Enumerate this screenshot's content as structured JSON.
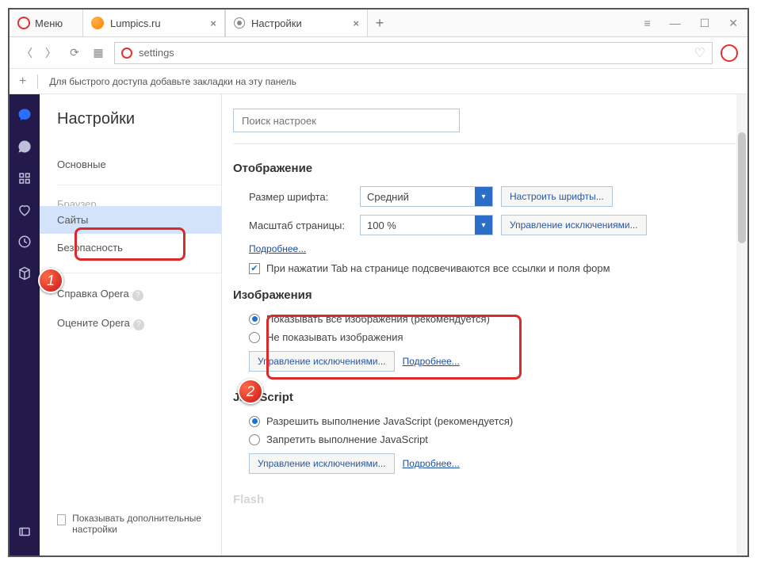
{
  "menu": "Меню",
  "tabs": [
    "Lumpics.ru",
    "Настройки"
  ],
  "url": "settings",
  "bookmarkbar_hint": "Для быстрого доступа добавьте закладки на эту панель",
  "nav_title": "Настройки",
  "nav": {
    "basic": "Основные",
    "browser": "Браузер",
    "sites": "Сайты",
    "security": "Безопасность",
    "help": "Справка Opera",
    "rate": "Оцените Opera"
  },
  "show_advanced": "Показывать дополнительные настройки",
  "search_placeholder": "Поиск настроек",
  "display": {
    "title": "Отображение",
    "font_size_label": "Размер шрифта:",
    "font_size_value": "Средний",
    "font_btn": "Настроить шрифты...",
    "zoom_label": "Масштаб страницы:",
    "zoom_value": "100 %",
    "zoom_btn": "Управление исключениями...",
    "more": "Подробнее...",
    "tab_highlight": "При нажатии Tab на странице подсвечиваются все ссылки и поля форм"
  },
  "images": {
    "title": "Изображения",
    "show_all": "Показывать все изображения (рекомендуется)",
    "hide": "Не показывать изображения",
    "exceptions": "Управление исключениями...",
    "more": "Подробнее..."
  },
  "javascript": {
    "title": "JavaScript",
    "allow": "Разрешить выполнение JavaScript (рекомендуется)",
    "deny": "Запретить выполнение JavaScript",
    "exceptions": "Управление исключениями...",
    "more": "Подробнее..."
  },
  "flash_title": "Flash",
  "badge1": "1",
  "badge2": "2"
}
